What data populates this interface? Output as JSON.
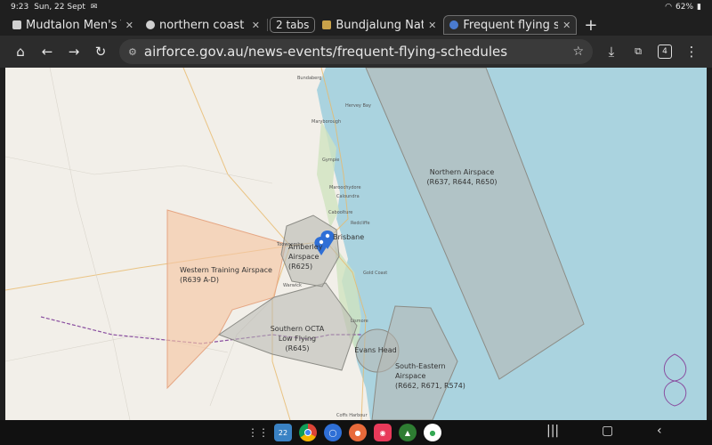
{
  "status_bar": {
    "time": "9:23",
    "date": "Sun, 22 Sept",
    "battery": "62%"
  },
  "tabs": [
    {
      "title": "Mudtalon Men's T",
      "active": false
    },
    {
      "title": "northern coast b",
      "active": false
    },
    {
      "title": "Bundjalung Natio",
      "active": false
    },
    {
      "title": "Frequent flying sc",
      "active": true
    }
  ],
  "tab_group_label": "2 tabs",
  "toolbar": {
    "url": "airforce.gov.au/news-events/frequent-flying-schedules",
    "tab_count": "4"
  },
  "map": {
    "airspaces": [
      {
        "name": "Northern Airspace",
        "codes": "(R637, R644, R650)"
      },
      {
        "name": "Western Training Airspace",
        "codes": "(R639 A-D)"
      },
      {
        "name": "Amberley Airspace",
        "codes": "(R625)"
      },
      {
        "name": "Southern OCTA Low Flying",
        "codes": "(R645)"
      },
      {
        "name": "Evans Head",
        "codes": ""
      },
      {
        "name": "South-Eastern Airspace",
        "codes": "(R662, R671, R574)"
      }
    ],
    "towns": [
      "Bundaberg",
      "Hervey Bay",
      "Maryborough",
      "Gympie",
      "Maroochydore",
      "Caloundra",
      "Caboolture",
      "Redcliffe",
      "Brisbane",
      "Toowoomba",
      "Gold Coast",
      "Warwick",
      "Lismore",
      "Coffs Harbour"
    ],
    "colors": {
      "land": "#f2efe9",
      "water": "#aad3df",
      "western_fill": "#f5c6a5",
      "grey_fill": "#b7b7b0",
      "border": "#8a4fa0"
    }
  },
  "dock": {
    "apps": [
      "calendar",
      "chrome",
      "messages",
      "contacts",
      "screen-recorder",
      "camping",
      "maps"
    ],
    "calendar_day": "22"
  }
}
